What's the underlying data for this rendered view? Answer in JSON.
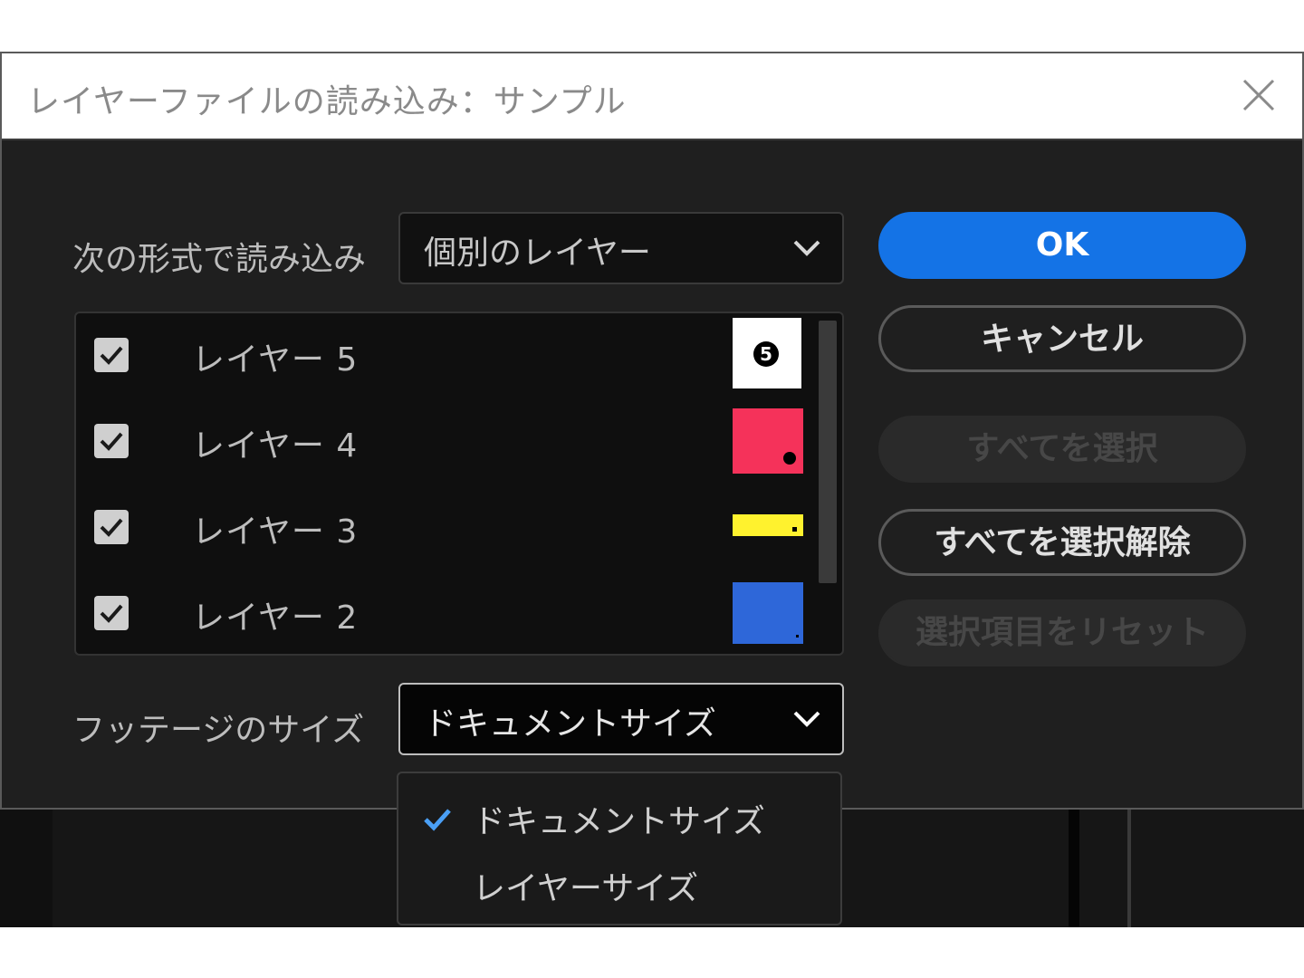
{
  "dialog": {
    "title": "レイヤーファイルの読み込み：サンプル",
    "import_as": {
      "label": "次の形式で読み込み",
      "selected": "個別のレイヤー"
    },
    "layers": [
      {
        "name": "レイヤー 5",
        "checked": true,
        "thumb_color": "#ffffff",
        "marker": "5"
      },
      {
        "name": "レイヤー 4",
        "checked": true,
        "thumb_color": "#f5325a",
        "marker": ""
      },
      {
        "name": "レイヤー 3",
        "checked": true,
        "thumb_color": "#fff22e",
        "marker": ""
      },
      {
        "name": "レイヤー 2",
        "checked": true,
        "thumb_color": "#2e67d9",
        "marker": ""
      }
    ],
    "footage_size": {
      "label": "フッテージのサイズ",
      "selected": "ドキュメントサイズ",
      "options": [
        {
          "label": "ドキュメントサイズ",
          "checked": true
        },
        {
          "label": "レイヤーサイズ",
          "checked": false
        }
      ]
    },
    "buttons": {
      "ok": "OK",
      "cancel": "キャンセル",
      "select_all": "すべてを選択",
      "deselect_all": "すべてを選択解除",
      "reset_selection": "選択項目をリセット"
    }
  },
  "colors": {
    "accent": "#1473e6",
    "check": "#4a9ff5"
  }
}
